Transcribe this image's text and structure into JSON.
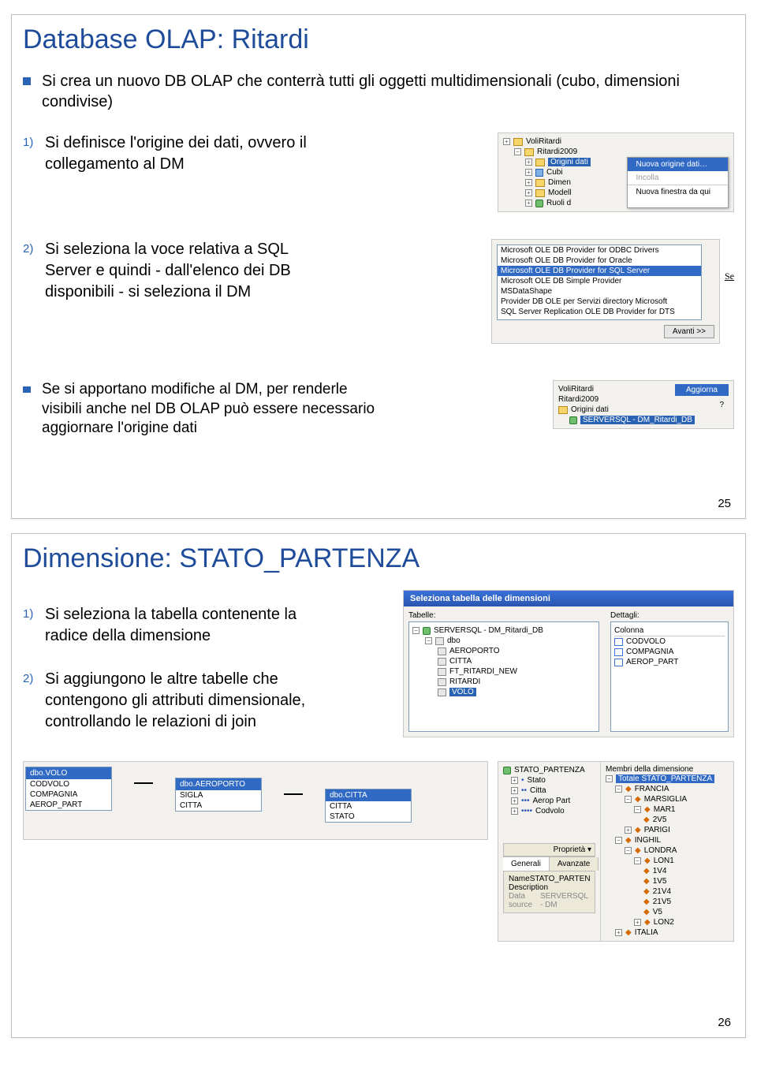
{
  "slide1": {
    "title": "Database OLAP: Ritardi",
    "intro": "Si crea un nuovo DB OLAP che conterrà tutti gli oggetti multidimensionali (cubo, dimensioni condivise)",
    "step1_num": "1)",
    "step1": "Si definisce l'origine dei dati, ovvero il collegamento al DM",
    "step2_num": "2)",
    "step2": "Si seleziona la voce relativa a SQL Server e quindi - dall'elenco dei DB disponibili - si seleziona il DM",
    "note": "Se si apportano modifiche al DM, per renderle visibili anche nel DB OLAP può essere necessario aggiornare l'origine dati",
    "page": "25",
    "tree": {
      "n1": "VoliRitardi",
      "n2": "Ritardi2009",
      "n3": "Origini dati",
      "n4": "Cubi",
      "n5": "Dimen",
      "n6": "Modell",
      "n7": "Ruoli d",
      "ctx1": "Nuova origine dati…",
      "ctx2": "Incolla",
      "ctx3": "Nuova finestra da qui"
    },
    "listbox": {
      "i1": "Microsoft OLE DB Provider for ODBC Drivers",
      "i2": "Microsoft OLE DB Provider for Oracle",
      "i3": "Microsoft OLE DB Provider for SQL Server",
      "i4": "Microsoft OLE DB Simple Provider",
      "i5": "MSDataShape",
      "i6": "Provider DB OLE per Servizi directory Microsoft",
      "i7": "SQL Server Replication OLE DB Provider for DTS",
      "btn": "Avanti >>"
    },
    "right_edge": "Se",
    "refresh": {
      "n1": "VoliRitardi",
      "n2": "Ritardi2009",
      "n3": "Origini dati",
      "q": "?",
      "sel": "SERVERSQL - DM_Ritardi_DB",
      "btn": "Aggiorna"
    }
  },
  "slide2": {
    "title": "Dimensione: STATO_PARTENZA",
    "step1_num": "1)",
    "step1": "Si seleziona la tabella contenente la radice della dimensione",
    "step2_num": "2)",
    "step2": "Si aggiungono le altre tabelle che contengono gli attributi dimensionale, controllando le relazioni di join",
    "page": "26",
    "dimpanel": {
      "titlebar": "Seleziona tabella delle dimensioni",
      "lbl_tabelle": "Tabelle:",
      "lbl_dettagli": "Dettagli:",
      "col_colonna": "Colonna",
      "src": "SERVERSQL - DM_Ritardi_DB",
      "dbo": "dbo",
      "t1": "AEROPORTO",
      "t2": "CITTA",
      "t3": "FT_RITARDI_NEW",
      "t4": "RITARDI",
      "t5": "VOLO",
      "c1": "CODVOLO",
      "c2": "COMPAGNIA",
      "c3": "AEROP_PART"
    },
    "schema": {
      "t1_hdr": "dbo.VOLO",
      "t1_r1": "CODVOLO",
      "t1_r2": "COMPAGNIA",
      "t1_r3": "AEROP_PART",
      "t2_hdr": "dbo.AEROPORTO",
      "t2_r1": "SIGLA",
      "t2_r2": "CITTA",
      "t3_hdr": "dbo.CITTA",
      "t3_r1": "CITTA",
      "t3_r2": "STATO"
    },
    "hier": {
      "leftTitle": "STATO_PARTENZA",
      "l1": "Stato",
      "l2": "Citta",
      "l3": "Aerop Part",
      "l4": "Codvolo",
      "rightTitle": "Membri della dimensione",
      "root": "Totale STATO_PARTENZA",
      "m1": "FRANCIA",
      "m1a": "MARSIGLIA",
      "m1a1": "MAR1",
      "m1a1a": "2V5",
      "m1b": "PARIGI",
      "m2": "INGHIL",
      "m2a": "LONDRA",
      "m2a1": "LON1",
      "m2a1a": "1V4",
      "m2a1b": "1V5",
      "m2a1c": "21V4",
      "m2a1d": "21V5",
      "m2a1e": "V5",
      "m2a2": "LON2",
      "m3": "ITALIA",
      "tab1": "Generali",
      "tab2": "Avanzate",
      "propBtn": "Proprietà",
      "p_name_lbl": "Name",
      "p_name_val": "STATO_PARTEN",
      "p_desc_lbl": "Description",
      "p_ds_lbl": "Data source",
      "p_ds_val": "SERVERSQL - DM"
    }
  }
}
